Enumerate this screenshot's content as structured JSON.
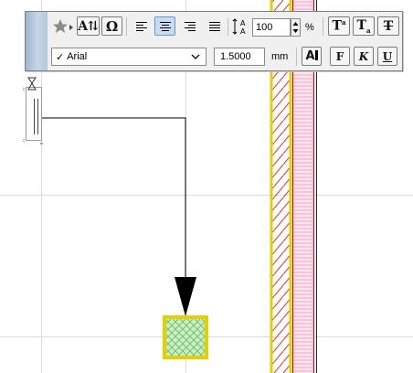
{
  "palette": {
    "row1": {
      "favorite_icon": "star-dropdown-icon",
      "text_fit_icon": "text-autofit-icon",
      "special_char_icon": "omega-icon",
      "align_left_icon": "align-left-icon",
      "align_center_icon": "align-center-icon",
      "align_right_icon": "align-right-icon",
      "justify_icon": "justify-icon",
      "line_spacing_icon": "line-spacing-icon",
      "line_spacing_value": "100",
      "line_spacing_unit": "%",
      "superscript_icon": "superscript-icon",
      "subscript_icon": "subscript-icon",
      "strikethrough_icon": "strikethrough-icon"
    },
    "row2": {
      "font_checkmark": "✓",
      "font_name": "Arial",
      "font_size_value": "1.5000",
      "font_size_unit": "mm",
      "text_color_icon": "text-color-icon",
      "bold_label": "F",
      "italic_label": "K",
      "underline_label": "U"
    },
    "accent_color": "#c7dcf3"
  },
  "drawing": {
    "wall_outline_color": "#e8d000",
    "wall_fill_color": "#fdeaf6",
    "hatch_color": "#ff0000",
    "fill_color": "#c8f0c0"
  }
}
